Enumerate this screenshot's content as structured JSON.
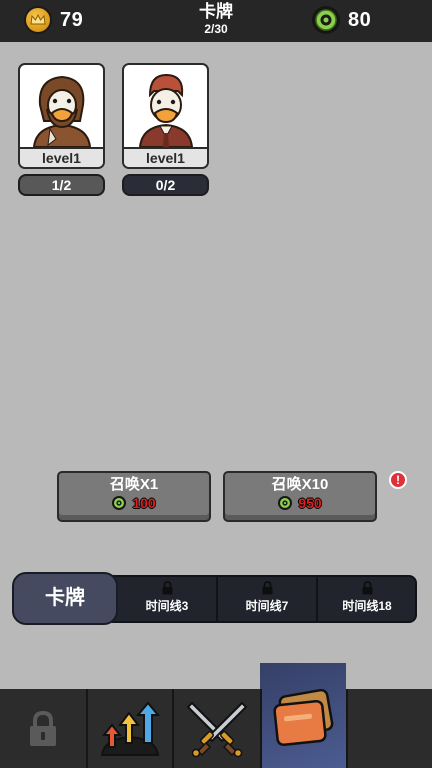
{
  "header": {
    "title": "卡牌",
    "subtitle": "2/30",
    "coins": "79",
    "gems": "80"
  },
  "cards": [
    {
      "level": "level1",
      "progress": "1/2",
      "portrait": "bearded-duck-man"
    },
    {
      "level": "level1",
      "progress": "0/2",
      "portrait": "suited-duck-man"
    }
  ],
  "summon": [
    {
      "label": "召唤X1",
      "cost": "100"
    },
    {
      "label": "召唤X10",
      "cost": "950"
    }
  ],
  "alert_badge": "!",
  "tabs": {
    "active": "卡牌",
    "locked": [
      "时间线3",
      "时间线7",
      "时间线18"
    ]
  },
  "bottom_nav": {
    "icons": [
      "lock-icon",
      "upgrade-arrows-icon",
      "crossed-swords-icon",
      "cards-icon"
    ],
    "active": "cards-icon"
  },
  "colors": {
    "background": "#b9b9b9",
    "topbar": "#262626",
    "tab_active": "#454a61",
    "cost_red": "#e21f1f",
    "gem_green": "#8bd04b",
    "coin_gold": "#e0a12a"
  }
}
